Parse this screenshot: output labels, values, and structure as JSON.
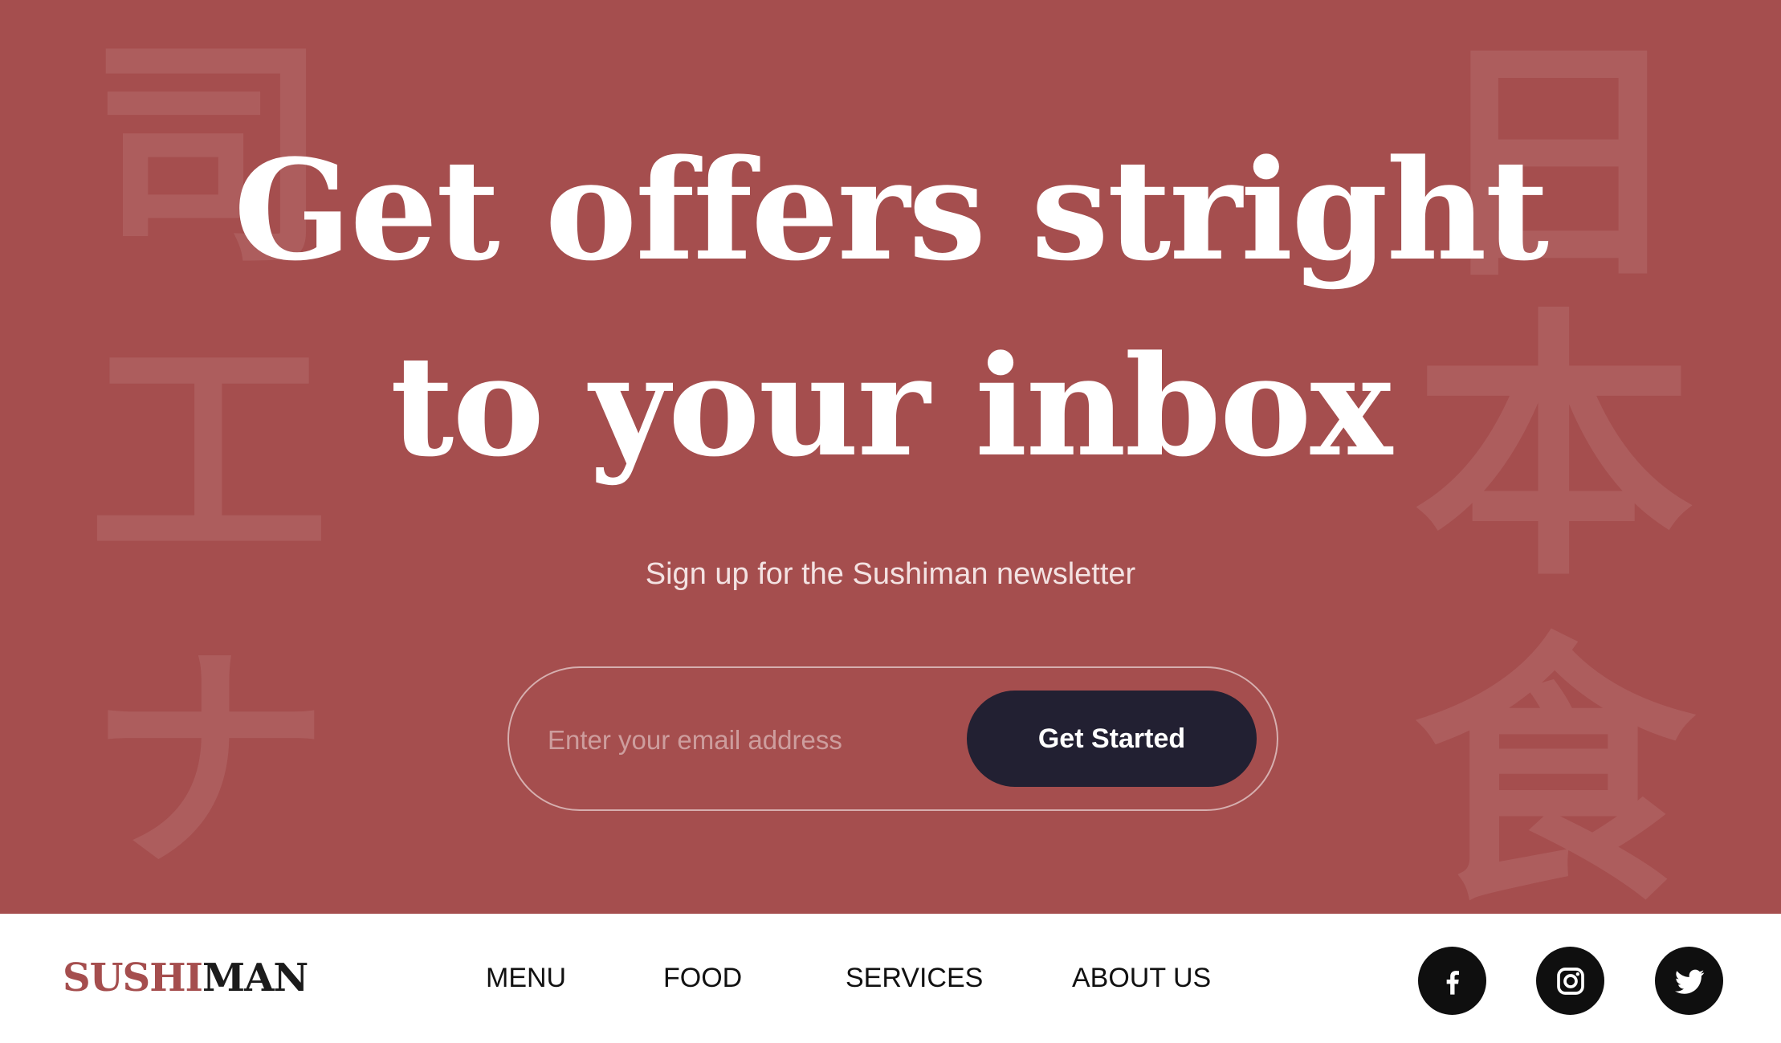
{
  "hero": {
    "headline_line1": "Get offers stright",
    "headline_line2": "to your inbox",
    "subtitle": "Sign up for the Sushiman newsletter",
    "decorative_left": [
      "司",
      "工",
      "ナ"
    ],
    "decorative_right": [
      "日",
      "本",
      "食"
    ],
    "background_color": "#a54e4e"
  },
  "signup": {
    "email_placeholder": "Enter your email address",
    "button_label": "Get Started",
    "button_color": "#222032"
  },
  "footer": {
    "logo_part1": "SUSHI",
    "logo_part2": "MAN",
    "logo_accent_color": "#a54e4e",
    "nav": [
      {
        "label": "MENU"
      },
      {
        "label": "FOOD"
      },
      {
        "label": "SERVICES"
      },
      {
        "label": "ABOUT US"
      }
    ],
    "social": [
      {
        "icon": "facebook-icon"
      },
      {
        "icon": "instagram-icon"
      },
      {
        "icon": "twitter-icon"
      }
    ]
  }
}
